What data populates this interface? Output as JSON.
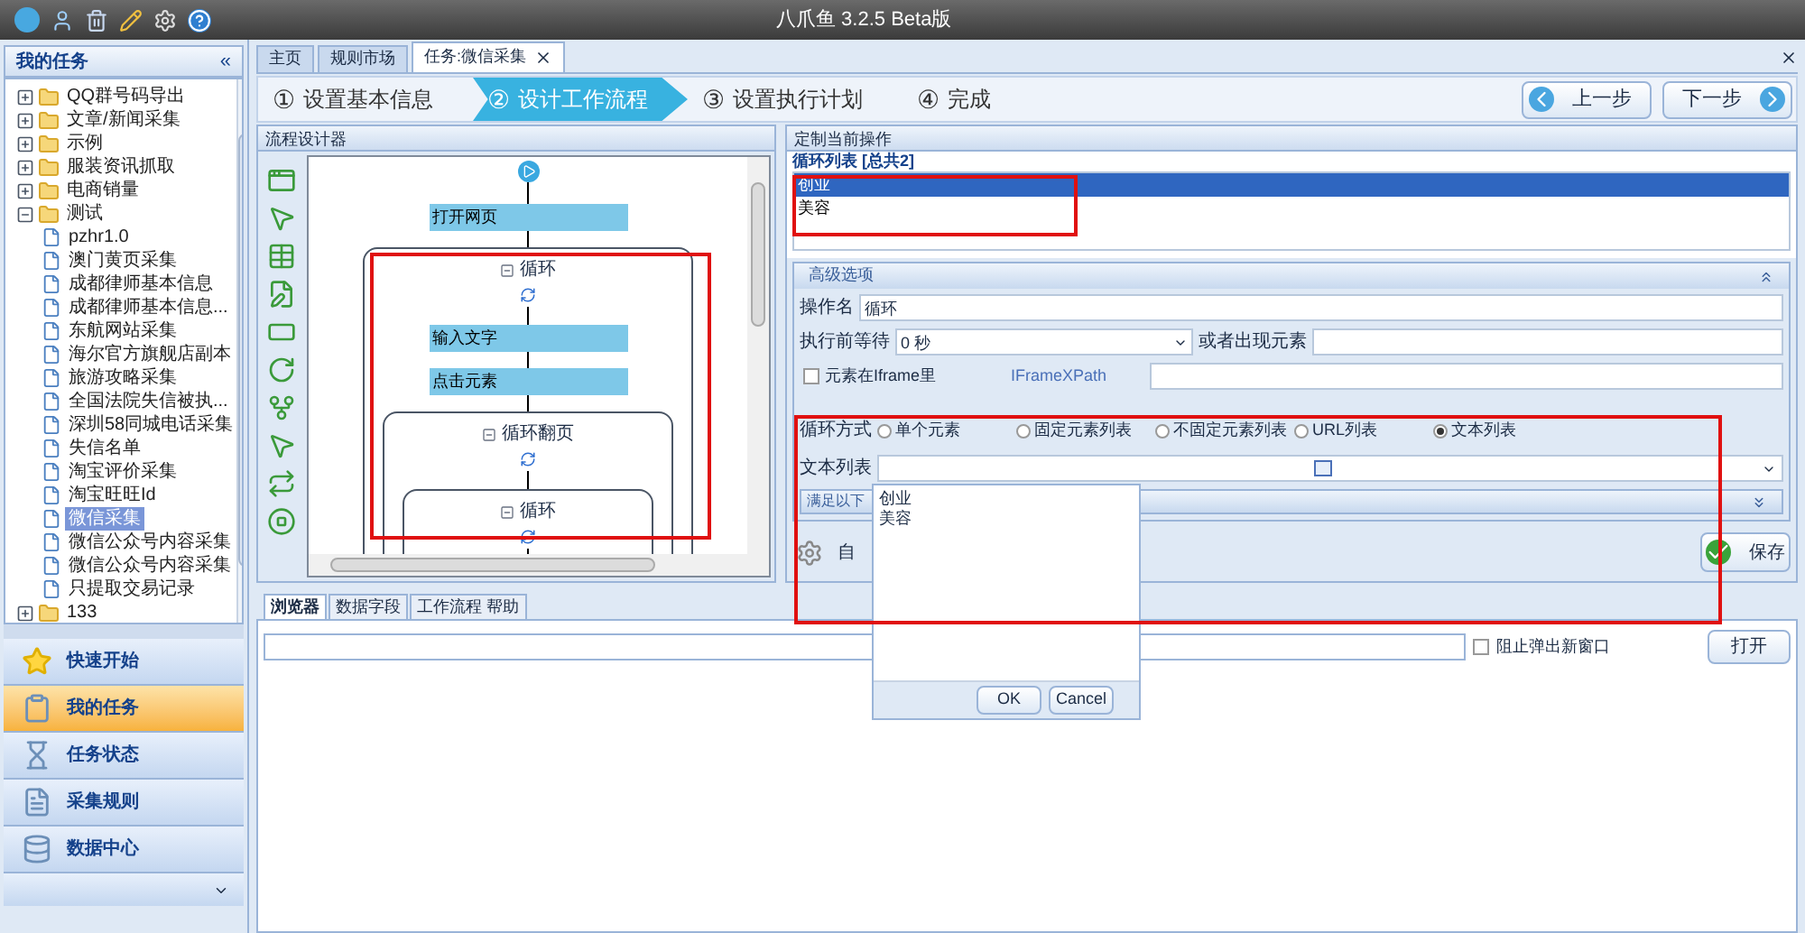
{
  "window": {
    "title": "八爪鱼 3.2.5 Beta版"
  },
  "sidebar": {
    "title": "我的任务",
    "collapse": "«",
    "tree": [
      {
        "label": "QQ群号码导出",
        "expanded": false,
        "selected": false
      },
      {
        "label": "文章/新闻采集",
        "expanded": false,
        "selected": false
      },
      {
        "label": "示例",
        "expanded": false,
        "selected": false
      },
      {
        "label": "服装资讯抓取",
        "expanded": false,
        "selected": false
      },
      {
        "label": "电商销量",
        "expanded": false,
        "selected": false
      },
      {
        "label": "测试",
        "expanded": true,
        "selected": false,
        "children": [
          {
            "label": "pzhr1.0",
            "selected": false
          },
          {
            "label": "澳门黄页采集",
            "selected": false
          },
          {
            "label": "成都律师基本信息",
            "selected": false
          },
          {
            "label": "成都律师基本信息...",
            "selected": false
          },
          {
            "label": "东航网站采集",
            "selected": false
          },
          {
            "label": "海尔官方旗舰店副本",
            "selected": false
          },
          {
            "label": "旅游攻略采集",
            "selected": false
          },
          {
            "label": "全国法院失信被执...",
            "selected": false
          },
          {
            "label": "深圳58同城电话采集",
            "selected": false
          },
          {
            "label": "失信名单",
            "selected": false
          },
          {
            "label": "淘宝评价采集",
            "selected": false
          },
          {
            "label": "淘宝旺旺Id",
            "selected": false
          },
          {
            "label": "微信采集",
            "selected": true
          },
          {
            "label": "微信公众号内容采集",
            "selected": false
          },
          {
            "label": "微信公众号内容采集",
            "selected": false
          },
          {
            "label": "只提取交易记录",
            "selected": false
          }
        ]
      },
      {
        "label": "133",
        "expanded": false,
        "selected": false
      }
    ],
    "nav": [
      {
        "label": "快速开始",
        "kind": "star",
        "selected": false
      },
      {
        "label": "我的任务",
        "kind": "clipboard",
        "selected": true
      },
      {
        "label": "任务状态",
        "kind": "hourglass",
        "selected": false
      },
      {
        "label": "采集规则",
        "kind": "document",
        "selected": false
      },
      {
        "label": "数据中心",
        "kind": "database",
        "selected": false
      }
    ]
  },
  "tabs": [
    {
      "label": "主页",
      "selected": false,
      "closable": false
    },
    {
      "label": "规则市场",
      "selected": false,
      "closable": false
    },
    {
      "label": "任务:微信采集",
      "selected": true,
      "closable": true
    }
  ],
  "steps": [
    {
      "number": "①",
      "label": "设置基本信息",
      "selected": false
    },
    {
      "number": "②",
      "label": "设计工作流程",
      "selected": true
    },
    {
      "number": "③",
      "label": "设置执行计划",
      "selected": false
    },
    {
      "number": "④",
      "label": "完成",
      "selected": false
    }
  ],
  "step_buttons": {
    "back": "上一步",
    "next": "下一步"
  },
  "flow_designer": {
    "title": "流程设计器",
    "nodes": [
      {
        "kind": "start"
      },
      {
        "kind": "action",
        "label": "打开网页"
      },
      {
        "kind": "loop",
        "label": "循环",
        "children": [
          {
            "kind": "action",
            "label": "输入文字"
          },
          {
            "kind": "action",
            "label": "点击元素"
          },
          {
            "kind": "loop",
            "label": "循环翻页",
            "children": [
              {
                "kind": "loop",
                "label": "循环"
              }
            ]
          }
        ]
      }
    ]
  },
  "operation": {
    "title": "定制当前操作",
    "list_title": "循环列表 [总共2]",
    "list": [
      {
        "label": "创业",
        "selected": true
      },
      {
        "label": "美容",
        "selected": false
      }
    ],
    "advanced_title": "高级选项",
    "name_label": "操作名",
    "name_value": "循环",
    "wait_label": "执行前等待",
    "wait_value": "0 秒",
    "or_label": "或者出现元素",
    "iframe": {
      "label": "元素在Iframe里",
      "checked": false
    },
    "xpath_label": "IFrameXPath",
    "mode_label": "循环方式",
    "modes": [
      {
        "label": "单个元素",
        "selected": false
      },
      {
        "label": "固定元素列表",
        "selected": false
      },
      {
        "label": "不固定元素列表",
        "selected": false
      },
      {
        "label": "URL列表",
        "selected": false
      },
      {
        "label": "文本列表",
        "selected": true
      }
    ],
    "text_list_label": "文本列表",
    "condition_title": "满足以下",
    "custom_button": "自",
    "save_button": "保存"
  },
  "bottom_tabs": [
    {
      "label": "浏览器",
      "selected": true
    },
    {
      "label": "数据字段",
      "selected": false
    },
    {
      "label": "工作流程 帮助",
      "selected": false
    }
  ],
  "browser": {
    "block_popup": {
      "label": "阻止弹出新窗口",
      "checked": false
    },
    "open_button": "打开"
  },
  "popup": {
    "lines": [
      "创业",
      "美容"
    ],
    "ok": "OK",
    "cancel": "Cancel"
  }
}
